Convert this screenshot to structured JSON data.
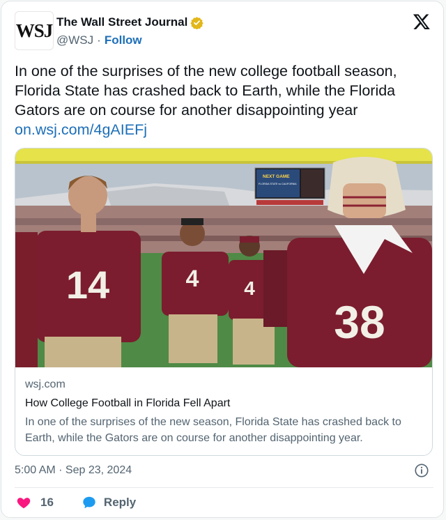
{
  "account": {
    "avatar_text": "WSJ",
    "name": "The Wall Street Journal",
    "handle": "@WSJ",
    "separator": "·",
    "follow_label": "Follow"
  },
  "tweet": {
    "text": "In one of the surprises of the new college football season, Florida State has crashed back to Earth, while the Florida Gators are on course for another disappointing year",
    "link": "on.wsj.com/4gAIEFj"
  },
  "photo": {
    "scoreboard_title": "NEXT GAME",
    "scoreboard_line": "FLORIDA STATE vs CALIFORNIA",
    "jersey_numbers": [
      "14",
      "4",
      "4",
      "38"
    ]
  },
  "link_card": {
    "domain": "wsj.com",
    "title": "How College Football in Florida Fell Apart",
    "description": "In one of the surprises of the new season, Florida State has crashed back to Earth, while the Gators are on course for another disappointing year."
  },
  "timestamp": "5:00 AM · Sep 23, 2024",
  "actions": {
    "like_count": "16",
    "reply_label": "Reply"
  },
  "colors": {
    "link": "#1d6fb8",
    "like": "#f91880",
    "reply": "#1d9bf0",
    "verified": "#e2b719"
  }
}
